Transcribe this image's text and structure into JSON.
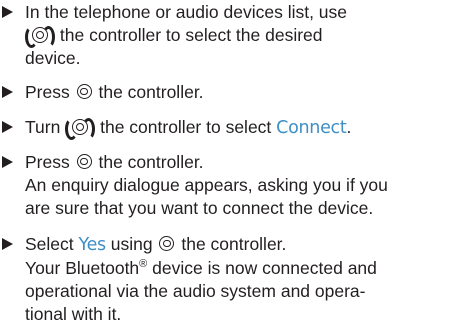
{
  "steps": [
    {
      "lines": [
        "In the telephone or audio devices list, use",
        "the controller to select the desired",
        "device."
      ]
    },
    {
      "before": "Press",
      "after": "the controller."
    },
    {
      "before": "Turn",
      "after": "the controller to select",
      "highlight": "Connect",
      "end": "."
    },
    {
      "before": "Press",
      "after": "the controller.",
      "extra": [
        "An enquiry dialogue appears, asking you if you",
        "are sure that you want to connect the device."
      ]
    },
    {
      "before": "Select",
      "highlight": "Yes",
      "mid": "using",
      "after": "the controller.",
      "extra": [
        "Your Bluetooth",
        "device is now connected and",
        "operational via the audio system and opera-",
        "tional with it."
      ],
      "registered": "®"
    }
  ],
  "icons": {
    "bullet": "triangle-bullet-icon",
    "turn": "turn-controller-icon",
    "press": "press-controller-icon"
  },
  "colors": {
    "text": "#231f20",
    "highlight": "#3f8fc4"
  }
}
